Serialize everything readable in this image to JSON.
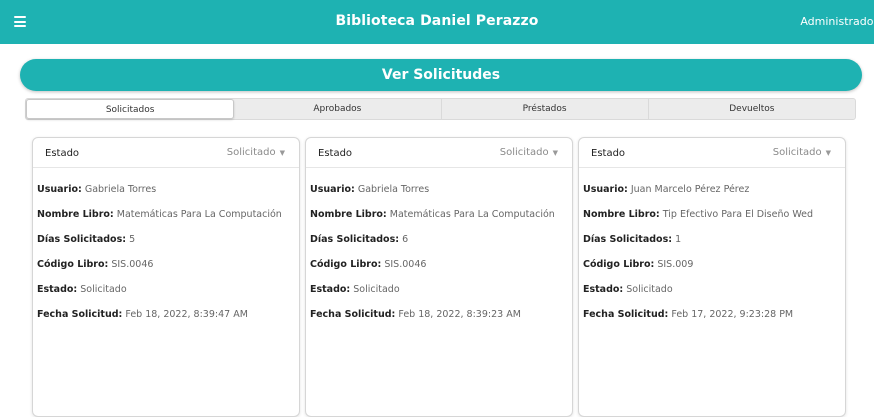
{
  "header": {
    "title": "Biblioteca Daniel Perazzo",
    "user": "Administrador"
  },
  "banner": {
    "title": "Ver Solicitudes"
  },
  "tabs": [
    "Solicitados",
    "Aprobados",
    "Préstados",
    "Devueltos"
  ],
  "labels": {
    "estado": "Estado",
    "usuario": "Usuario:",
    "libro": "Nombre Libro:",
    "dias": "Días Solicitados:",
    "codigo": "Código Libro:",
    "estado_field": "Estado:",
    "fecha": "Fecha Solicitud:"
  },
  "cards": [
    {
      "select": "Solicitado",
      "usuario": "Gabriela Torres",
      "libro": "Matemáticas Para La Computación",
      "dias": "5",
      "codigo": "SIS.0046",
      "estado": "Solicitado",
      "fecha": "Feb 18, 2022, 8:39:47 AM"
    },
    {
      "select": "Solicitado",
      "usuario": "Gabriela Torres",
      "libro": "Matemáticas Para La Computación",
      "dias": "6",
      "codigo": "SIS.0046",
      "estado": "Solicitado",
      "fecha": "Feb 18, 2022, 8:39:23 AM"
    },
    {
      "select": "Solicitado",
      "usuario": "Juan Marcelo Pérez Pérez",
      "libro": "Tip Efectivo Para El Diseño Wed",
      "dias": "1",
      "codigo": "SIS.009",
      "estado": "Solicitado",
      "fecha": "Feb 17, 2022, 9:23:28 PM"
    }
  ]
}
